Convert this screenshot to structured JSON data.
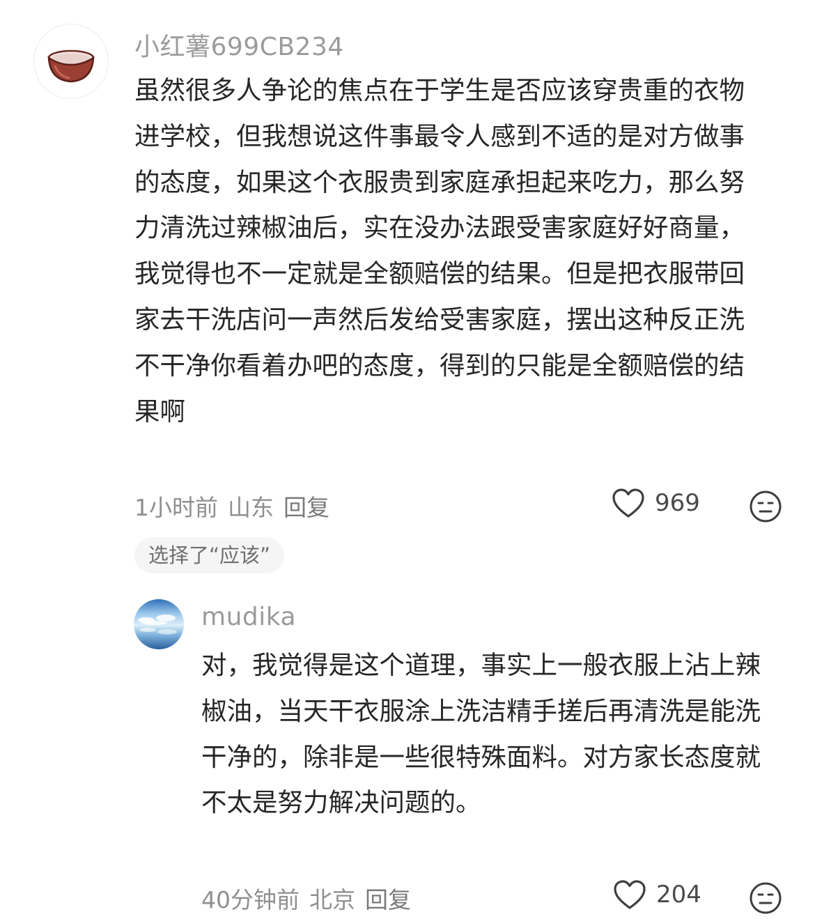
{
  "comments": [
    {
      "username": "小红薯699CB234",
      "avatar_icon": "bowl-icon",
      "text": "虽然很多人争论的焦点在于学生是否应该穿贵重的衣物进学校，但我想说这件事最令人感到不适的是对方做事的态度，如果这个衣服贵到家庭承担起来吃力，那么努力清洗过辣椒油后，实在没办法跟受害家庭好好商量，我觉得也不一定就是全额赔偿的结果。但是把衣服带回家去干洗店问一声然后发给受害家庭，摆出这种反正洗不干净你看着办吧的态度，得到的只能是全额赔偿的结果啊",
      "time": "1小时前",
      "location": "山东",
      "reply_label": "回复",
      "likes": "969",
      "tag": "选择了“应该”"
    },
    {
      "username": "mudika",
      "avatar_icon": "sky-sea-avatar",
      "text": "对，我觉得是这个道理，事实上一般衣服上沾上辣椒油，当天干衣服涂上洗洁精手搓后再清洗是能洗干净的，除非是一些很特殊面料。对方家长态度就不太是努力解决问题的。",
      "time": "40分钟前",
      "location": "北京",
      "reply_label": "回复",
      "likes": "204"
    }
  ],
  "icons": {
    "like": "heart-outline-icon",
    "reaction": "neutral-face-icon"
  }
}
